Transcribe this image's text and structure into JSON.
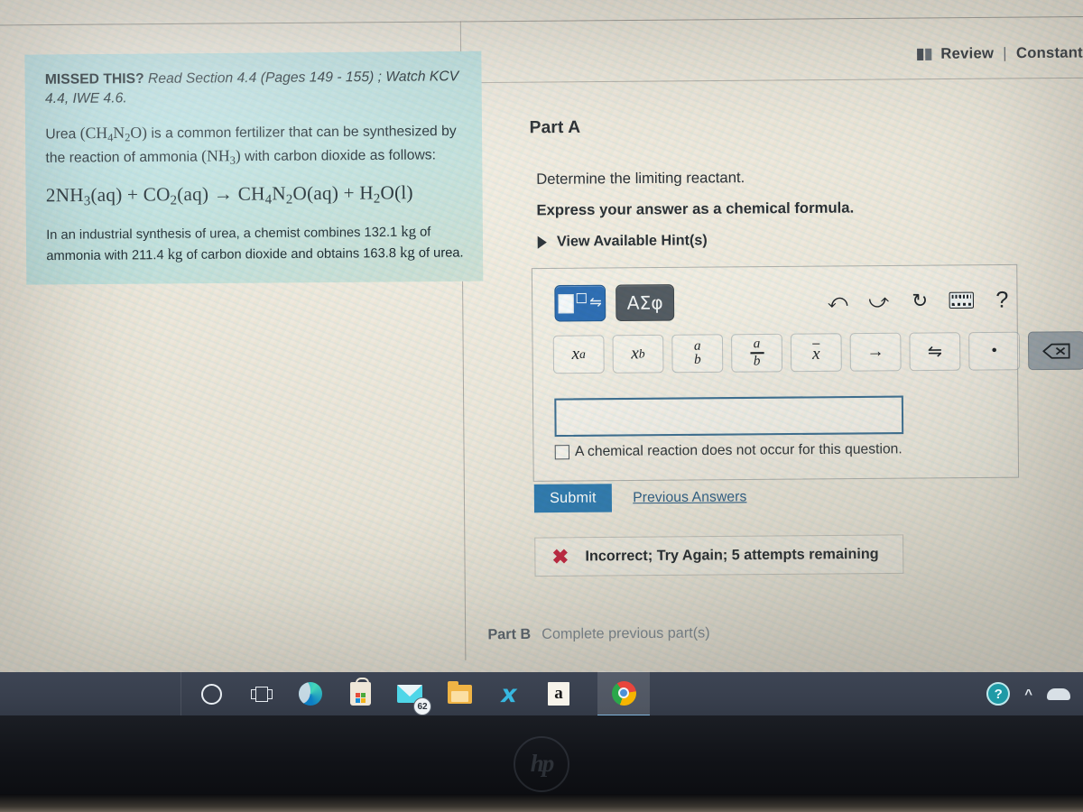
{
  "header": {
    "review_label": "Review",
    "separator": "|",
    "constants_label": "Constants",
    "book_icon": "book-icon"
  },
  "problem": {
    "missed_prefix": "MISSED THIS?",
    "missed_body": "Read Section 4.4 (Pages 149 - 155) ; Watch KCV 4.4, IWE 4.6.",
    "intro_1": "Urea",
    "intro_formula_urea": "CH4N2O",
    "intro_2": "is a common fertilizer that can be synthesized by the reaction of ammonia",
    "intro_formula_ammonia": "NH3",
    "intro_3": "with carbon dioxide as follows:",
    "equation": "2NH3(aq) + CO2(aq) → CH4N2O(aq) + H2O(l)",
    "detail": "In an industrial synthesis of urea, a chemist combines 132.1 kg of ammonia with 211.4 kg of carbon dioxide and obtains 163.8 kg of urea.",
    "values": {
      "ammonia_mass": "132.1 kg",
      "carbon_dioxide_mass": "211.4 kg",
      "urea_mass": "163.8 kg",
      "section": "4.4",
      "pages": "149 - 155",
      "kcv": "KCV 4.4",
      "iwe": "IWE 4.6"
    }
  },
  "part_a": {
    "title": "Part A",
    "caret_icon": "caret-down-icon",
    "question": "Determine the limiting reactant.",
    "instruction": "Express your answer as a chemical formula.",
    "hints_label": "View Available Hint(s)",
    "hints_caret_icon": "caret-right-icon"
  },
  "toolbar": {
    "template_button": "template-button",
    "greek_button": "ΑΣφ",
    "undo_icon": "undo-icon",
    "redo_icon": "redo-icon",
    "reset_icon": "reset-icon",
    "keyboard_icon": "keyboard-icon",
    "help_label": "?",
    "symbols": [
      {
        "name": "superscript",
        "label": "xᵃ"
      },
      {
        "name": "subscript",
        "label": "x_b"
      },
      {
        "name": "mixed-number",
        "num": "a",
        "den": "b"
      },
      {
        "name": "fraction",
        "num": "a",
        "den": "b"
      },
      {
        "name": "overbar",
        "label": "x"
      },
      {
        "name": "right-arrow",
        "label": "→"
      },
      {
        "name": "equilibrium-arrow",
        "label": "⇌"
      },
      {
        "name": "dot-operator",
        "label": "•"
      },
      {
        "name": "backspace",
        "label": "⌫"
      },
      {
        "name": "keyboard-toggle",
        "label": "keyboard-up"
      }
    ]
  },
  "answer": {
    "input_value": "",
    "input_placeholder": "",
    "no_reaction_label": "A chemical reaction does not occur for this question.",
    "no_reaction_checked": false
  },
  "actions": {
    "submit_label": "Submit",
    "previous_answers_label": "Previous Answers"
  },
  "feedback": {
    "icon": "x-mark-icon",
    "message": "Incorrect; Try Again; 5 attempts remaining",
    "attempts_remaining": "5",
    "color": "#c0253f"
  },
  "part_b": {
    "label": "Part B",
    "note": "Complete previous part(s)"
  },
  "taskbar": {
    "items": [
      {
        "name": "cortana-icon",
        "label": "Cortana"
      },
      {
        "name": "task-view-icon",
        "label": "Task View"
      },
      {
        "name": "edge-icon",
        "label": "Microsoft Edge"
      },
      {
        "name": "microsoft-store-icon",
        "label": "Microsoft Store"
      },
      {
        "name": "mail-icon",
        "label": "Mail",
        "badge": "62"
      },
      {
        "name": "file-explorer-icon",
        "label": "File Explorer"
      },
      {
        "name": "bolt-app-icon",
        "label": "S"
      },
      {
        "name": "amazon-icon",
        "label": "a"
      },
      {
        "name": "chrome-icon",
        "label": "Google Chrome",
        "active": true
      }
    ],
    "tray": [
      {
        "name": "help-icon",
        "label": "?"
      },
      {
        "name": "show-hidden-icons-chevron",
        "label": "^"
      },
      {
        "name": "cloud-icon",
        "label": ""
      }
    ]
  },
  "device": {
    "brand": "hp"
  },
  "colors": {
    "accent_blue": "#2e7ab0",
    "template_button": "#2f6fb5",
    "problem_panel": "#b6dfe4",
    "error_red": "#c0253f",
    "link_blue": "#2d5d84",
    "taskbar": "#3d4554"
  }
}
